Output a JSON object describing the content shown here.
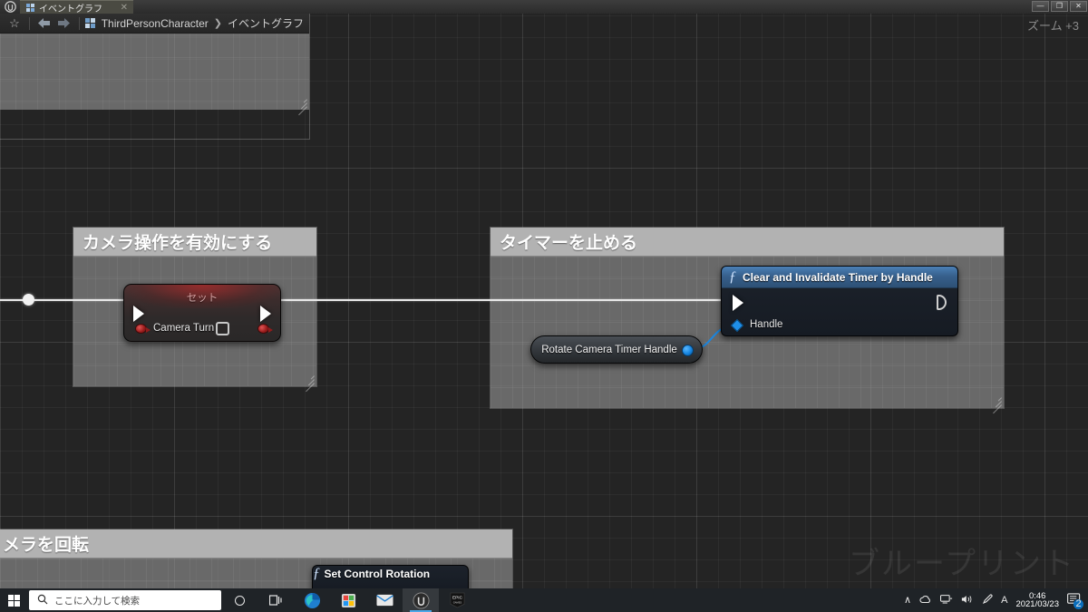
{
  "window": {
    "app_logo": "unreal-logo",
    "tab_label": "イベントグラフ",
    "tab_close": "✕",
    "minimize": "—",
    "restore": "❐",
    "close": "✕"
  },
  "toolbar": {
    "favorite_icon": "☆",
    "back_icon": "◀",
    "forward_icon": "▶",
    "breadcrumb_root": "ThirdPersonCharacter",
    "breadcrumb_sep": "❯",
    "breadcrumb_leaf": "イベントグラフ",
    "zoom_label": "ズーム +3"
  },
  "graph": {
    "watermark": "ブループリント",
    "ghost_text": "Rotate Camera Timer Handle",
    "comments": [
      {
        "id": "camera",
        "title": "カメラ操作を有効にする"
      },
      {
        "id": "timer",
        "title": "タイマーを止める"
      },
      {
        "id": "rotate",
        "title": "メラを回転"
      },
      {
        "id": "topleft",
        "title": ""
      }
    ],
    "nodes": {
      "set": {
        "title": "セット",
        "pin_label": "Camera Turn",
        "checkbox_value": "unchecked",
        "header_color": "#b52a2a"
      },
      "clear_timer": {
        "title": "Clear and Invalidate Timer by Handle",
        "fn_icon": "ƒ",
        "input_pin": "Handle",
        "header_color": "#37608c"
      },
      "variable_pill": {
        "label": "Rotate Camera Timer Handle",
        "pin_color": "#1484e0"
      },
      "set_control_rotation": {
        "title": "Set Control Rotation",
        "fn_icon": "ƒ",
        "header_color": "#37608c"
      }
    }
  },
  "taskbar": {
    "start_icon": "start-icon",
    "search_icon": "🔍",
    "search_placeholder": "ここに入力して検索",
    "cortana_icon": "cortana-icon",
    "taskview_icon": "task-view-icon",
    "apps": [
      {
        "name": "edge",
        "glyph": "edge-icon"
      },
      {
        "name": "store",
        "glyph": "store-icon"
      },
      {
        "name": "mail",
        "glyph": "mail-icon"
      },
      {
        "name": "unreal",
        "glyph": "unreal-icon"
      },
      {
        "name": "epic",
        "glyph": "epic-icon"
      }
    ],
    "tray": {
      "chevron": "∧",
      "onedrive": "onedrive-icon",
      "network": "network-icon",
      "volume": "volume-icon",
      "pen": "pen-icon",
      "ime": "A",
      "time": "0:46",
      "date": "2021/03/23",
      "notification_count": "2"
    }
  }
}
